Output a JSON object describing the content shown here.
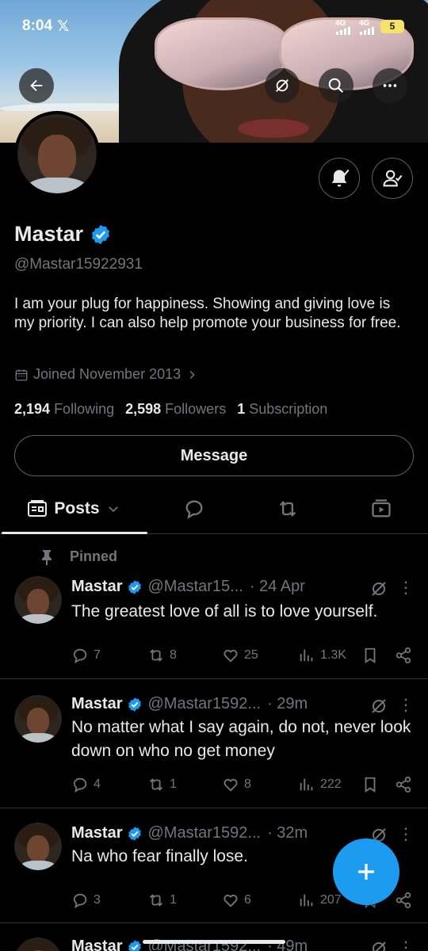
{
  "status_bar": {
    "time": "8:04",
    "x_logo": "𝕏",
    "net1": "4G",
    "net2": "4G",
    "battery": "5"
  },
  "profile": {
    "name": "Mastar",
    "handle": "@Mastar15922931",
    "bio": "I am your plug for happiness. Showing and giving love is my priority. I can also help promote your business for free.",
    "joined": "Joined November 2013",
    "following_count": "2,194",
    "following_label": "Following",
    "followers_count": "2,598",
    "followers_label": "Followers",
    "subscription_count": "1",
    "subscription_label": "Subscription",
    "message_label": "Message"
  },
  "tabs": {
    "posts_label": "Posts"
  },
  "pinned_label": "Pinned",
  "posts": [
    {
      "name": "Mastar",
      "handle": "@Mastar15...",
      "time": "· 24 Apr",
      "text": "The greatest love of all is to love yourself.",
      "replies": "7",
      "reposts": "8",
      "likes": "25",
      "views": "1.3K"
    },
    {
      "name": "Mastar",
      "handle": "@Mastar1592...",
      "time": "· 29m",
      "text": "No matter what I say again, do not, never look down on who no get money",
      "replies": "4",
      "reposts": "1",
      "likes": "8",
      "views": "222"
    },
    {
      "name": "Mastar",
      "handle": "@Mastar1592...",
      "time": "· 32m",
      "text": "Na who fear finally lose.",
      "replies": "3",
      "reposts": "1",
      "likes": "6",
      "views": "207"
    },
    {
      "name": "Mastar",
      "handle": "@Mastar1592...",
      "time": "· 49m"
    }
  ],
  "colors": {
    "accent": "#1d9bf0",
    "background": "#000000",
    "muted": "#71767b",
    "border": "#2f3336"
  },
  "icons": [
    "back-arrow-icon",
    "grok-icon",
    "search-icon",
    "more-icon",
    "bell-icon",
    "follow-check-icon",
    "verified-icon",
    "calendar-icon",
    "chevron-right-icon",
    "posts-tab-icon",
    "chevron-down-icon",
    "replies-tab-icon",
    "reposts-tab-icon",
    "media-tab-icon",
    "pin-icon",
    "reply-icon",
    "repost-icon",
    "like-icon",
    "views-icon",
    "bookmark-icon",
    "share-icon",
    "plus-icon"
  ]
}
